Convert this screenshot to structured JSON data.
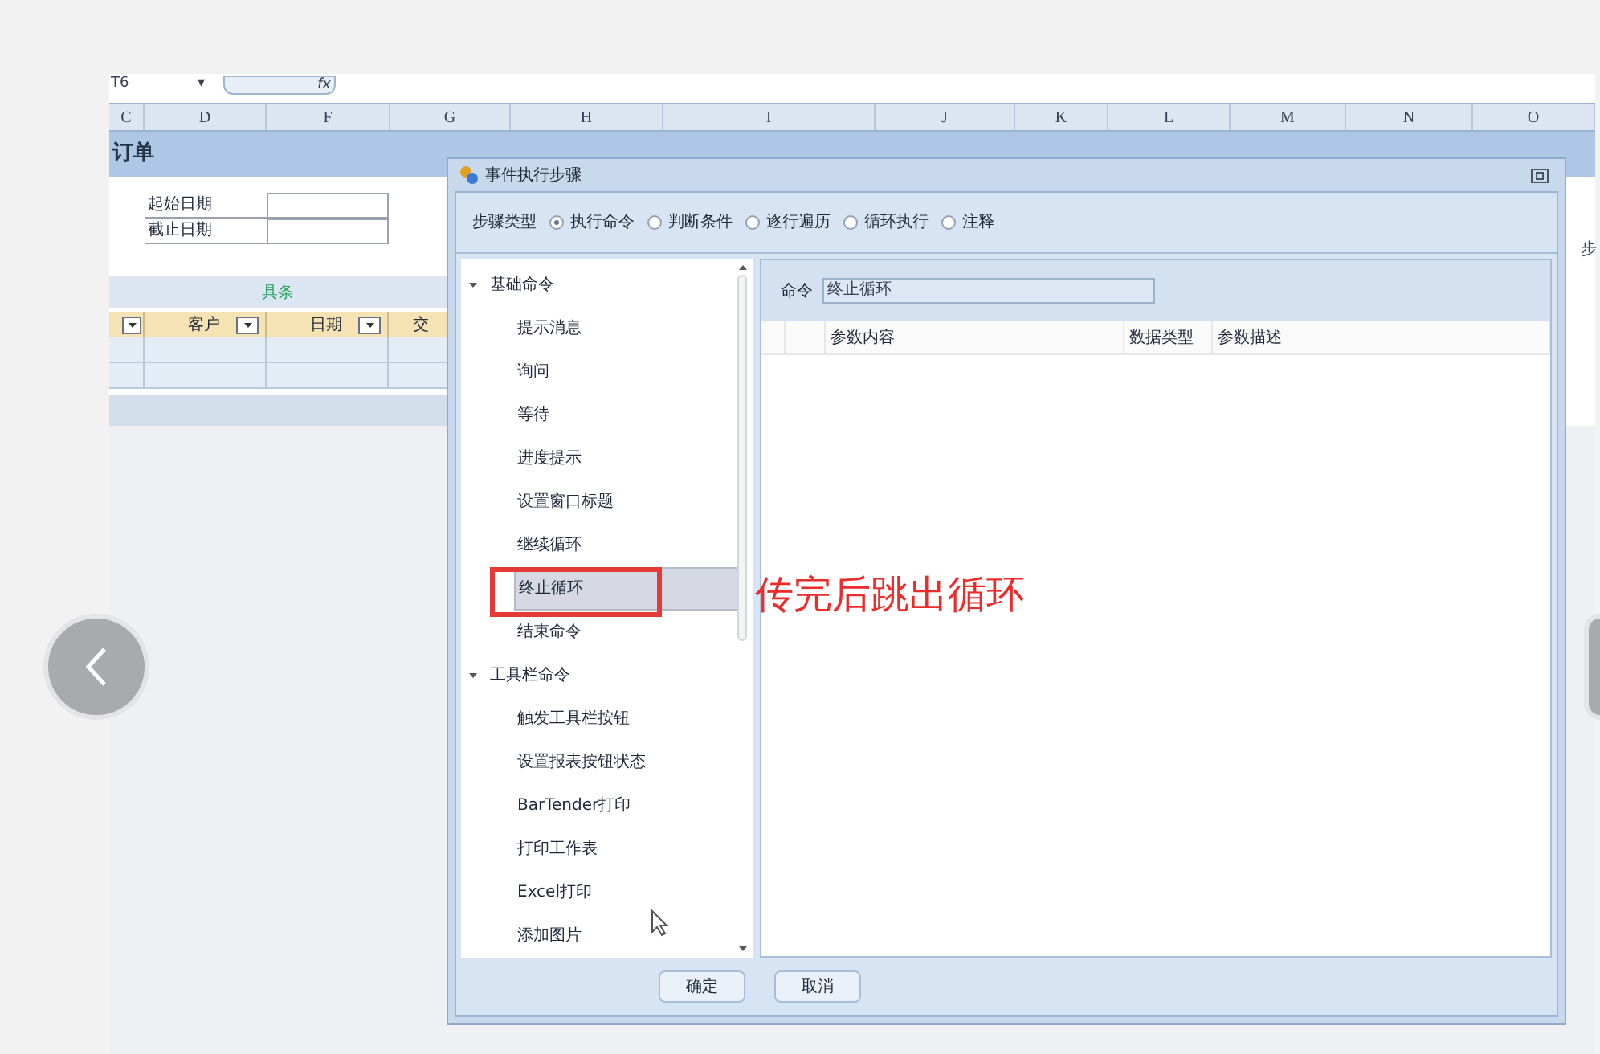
{
  "sheet": {
    "name_box": "T6",
    "name_box_caret": "▾",
    "fx_label": "fx",
    "columns": [
      "C",
      "D",
      "F",
      "G",
      "H",
      "I",
      "J",
      "K",
      "L",
      "M",
      "N",
      "O"
    ],
    "title": "订单",
    "date_fields": [
      {
        "label": "起始日期"
      },
      {
        "label": "截止日期"
      }
    ],
    "group_header": "具条",
    "table_headers": [
      {
        "label": "客户",
        "filter": true
      },
      {
        "label": "日期",
        "filter": true
      },
      {
        "label": "交",
        "filter": false
      }
    ],
    "side_label": "步"
  },
  "dialog": {
    "title": "事件执行步骤",
    "step_type_label": "步骤类型",
    "step_types": [
      {
        "label": "执行命令",
        "selected": true
      },
      {
        "label": "判断条件",
        "selected": false
      },
      {
        "label": "逐行遍历",
        "selected": false
      },
      {
        "label": "循环执行",
        "selected": false
      },
      {
        "label": "注释",
        "selected": false
      }
    ],
    "tree": [
      {
        "label": "基础命令",
        "expanded": true,
        "children": [
          {
            "label": "提示消息",
            "selected": false
          },
          {
            "label": "询问",
            "selected": false
          },
          {
            "label": "等待",
            "selected": false
          },
          {
            "label": "进度提示",
            "selected": false
          },
          {
            "label": "设置窗口标题",
            "selected": false
          },
          {
            "label": "继续循环",
            "selected": false
          },
          {
            "label": "终止循环",
            "selected": true
          },
          {
            "label": "结束命令",
            "selected": false
          }
        ]
      },
      {
        "label": "工具栏命令",
        "expanded": true,
        "children": [
          {
            "label": "触发工具栏按钮",
            "selected": false
          },
          {
            "label": "设置报表按钮状态",
            "selected": false
          },
          {
            "label": "BarTender打印",
            "selected": false
          },
          {
            "label": "打印工作表",
            "selected": false
          },
          {
            "label": "Excel打印",
            "selected": false
          },
          {
            "label": "添加图片",
            "selected": false
          }
        ]
      }
    ],
    "command_label": "命令",
    "command_value": "终止循环",
    "param_columns": [
      "参数内容",
      "数据类型",
      "参数描述"
    ],
    "buttons": [
      "确定",
      "取消"
    ]
  },
  "annotation": {
    "text": "传完后跳出循环"
  }
}
